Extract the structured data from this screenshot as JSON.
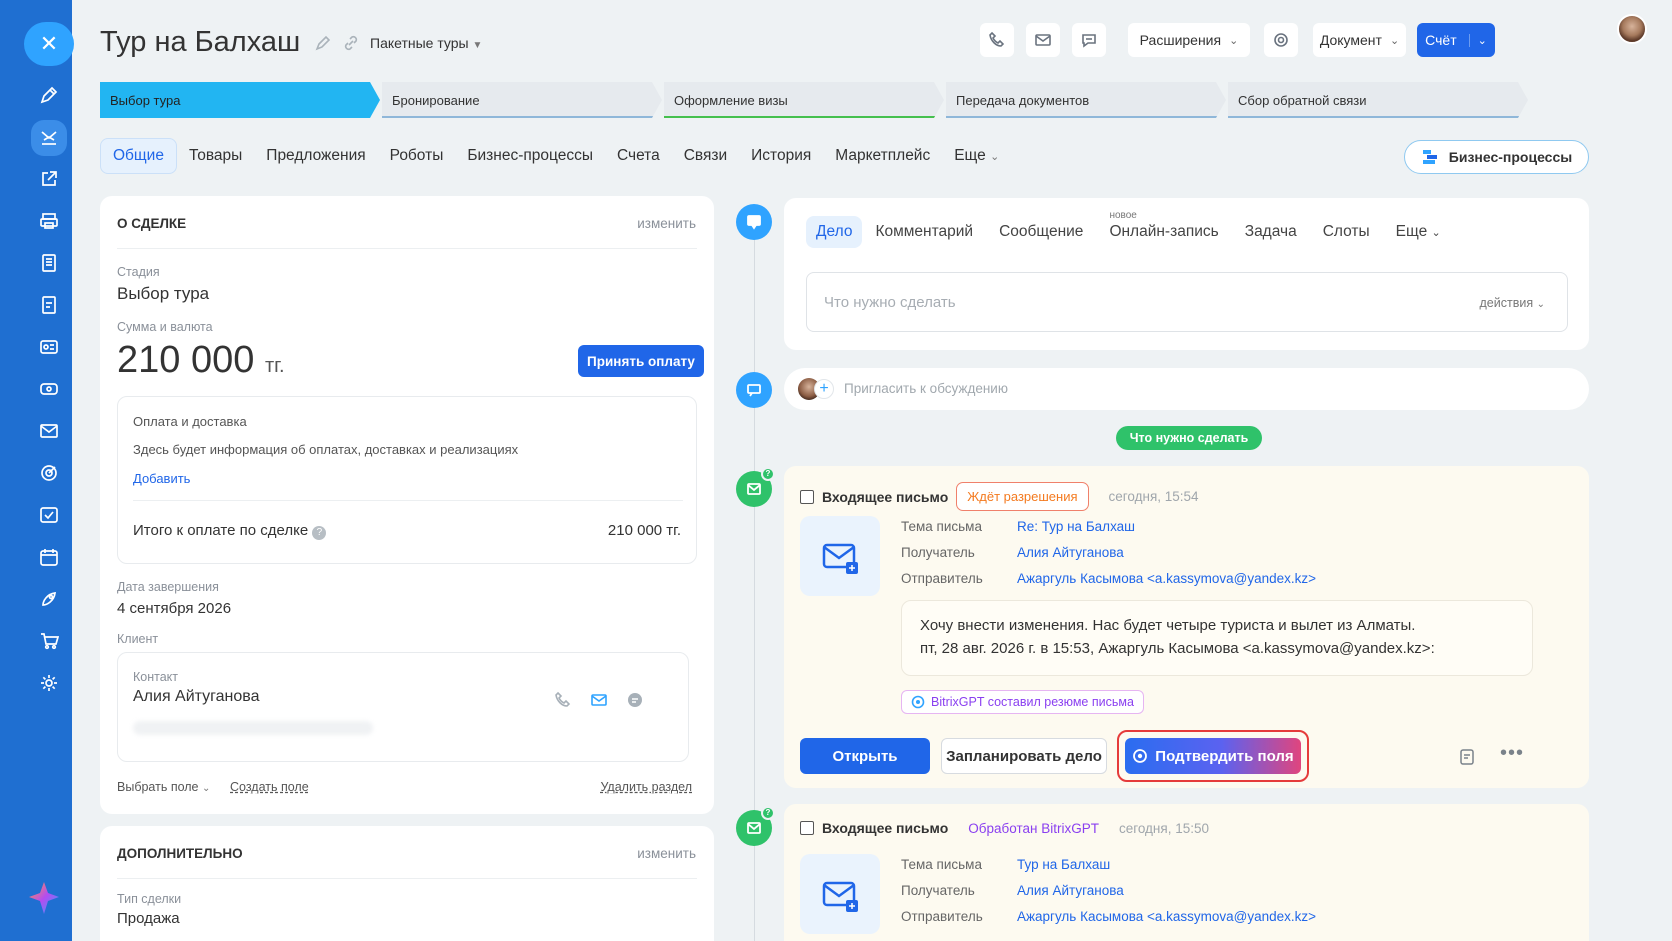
{
  "sidebar": {
    "icons": [
      "close-icon",
      "pen-icon",
      "deals-icon",
      "export-icon",
      "print-icon",
      "document-icon",
      "invoice-icon",
      "id-card-icon",
      "ticket-icon",
      "mail-icon",
      "target-icon",
      "check-mail-icon",
      "calendar-icon",
      "rocket-icon",
      "cart-icon",
      "gear-icon",
      "ai-star-icon"
    ]
  },
  "header": {
    "title": "Тур на Балхаш",
    "tour_type": "Пакетные туры",
    "extensions": "Расширения",
    "document": "Документ",
    "invoice": "Счёт"
  },
  "stages": [
    {
      "label": "Выбор тура",
      "color": "#22b5f2"
    },
    {
      "label": "Бронирование",
      "color": "#8fb7d9"
    },
    {
      "label": "Оформление визы",
      "color": "#45c04e"
    },
    {
      "label": "Передача документов",
      "color": "#8fb7d9"
    },
    {
      "label": "Сбор обратной связи",
      "color": "#8fb7d9"
    }
  ],
  "tabs": [
    "Общие",
    "Товары",
    "Предложения",
    "Роботы",
    "Бизнес-процессы",
    "Счета",
    "Связи",
    "История",
    "Маркетплейс",
    "Еще"
  ],
  "bp_button": "Бизнес-процессы",
  "deal": {
    "heading": "О СДЕЛКЕ",
    "edit": "изменить",
    "stage_label": "Стадия",
    "stage_value": "Выбор тура",
    "sum_label": "Сумма и валюта",
    "sum_value": "210 000",
    "currency": "тг.",
    "accept_payment": "Принять оплату",
    "payment_title": "Оплата и доставка",
    "payment_info": "Здесь будет информация об оплатах, доставках и реализациях",
    "add": "Добавить",
    "total_label": "Итого к оплате по сделке",
    "total_value": "210 000 тг.",
    "close_date_label": "Дата завершения",
    "close_date": "4 сентября 2026",
    "client_label": "Клиент",
    "contact_label": "Контакт",
    "contact_name": "Алия Айтуганова",
    "select_field": "Выбрать поле",
    "create_field": "Создать поле",
    "delete_section": "Удалить раздел"
  },
  "extra": {
    "heading": "ДОПОЛНИТЕЛЬНО",
    "edit": "изменить",
    "type_label": "Тип сделки",
    "type_value": "Продажа"
  },
  "activity": {
    "tabs": [
      "Дело",
      "Комментарий",
      "Сообщение",
      "Онлайн-запись",
      "Задача",
      "Слоты",
      "Еще"
    ],
    "new_badge": "новое",
    "placeholder": "Что нужно сделать",
    "actions": "действия",
    "invite": "Пригласить к обсуждению",
    "todo_pill": "Что нужно сделать"
  },
  "mail1": {
    "title": "Входящее письмо",
    "badge": "Ждёт разрешения",
    "time": "сегодня, 15:54",
    "subject_label": "Тема письма",
    "subject": "Re: Тур на Балхаш",
    "recipient_label": "Получатель",
    "recipient": "Алия Айтуганова",
    "sender_label": "Отправитель",
    "sender": "Ажаргуль Касымова <a.kassymova@yandex.kz>",
    "body1": "Хочу внести изменения. Нас будет четыре туриста и вылет из Алматы.",
    "body2": "пт, 28 авг. 2026 г. в 15:53, Ажаргуль Касымова <a.kassymova@yandex.kz>:",
    "gpt_tag": "BitrixGPT составил резюме письма",
    "open": "Открыть",
    "plan": "Запланировать дело",
    "confirm": "Подтвердить поля"
  },
  "mail2": {
    "title": "Входящее письмо",
    "badge": "Обработан BitrixGPT",
    "time": "сегодня, 15:50",
    "subject_label": "Тема письма",
    "subject": "Тур на Балхаш",
    "recipient_label": "Получатель",
    "recipient": "Алия Айтуганова",
    "sender_label": "Отправитель",
    "sender": "Ажаргуль Касымова <a.kassymova@yandex.kz>"
  },
  "colors": {
    "sidebar": "#1f6fd1",
    "accent": "#2066e8",
    "green": "#2fc26a",
    "orange": "#f47a1f",
    "gpt_purple": "#8a3ff0"
  }
}
